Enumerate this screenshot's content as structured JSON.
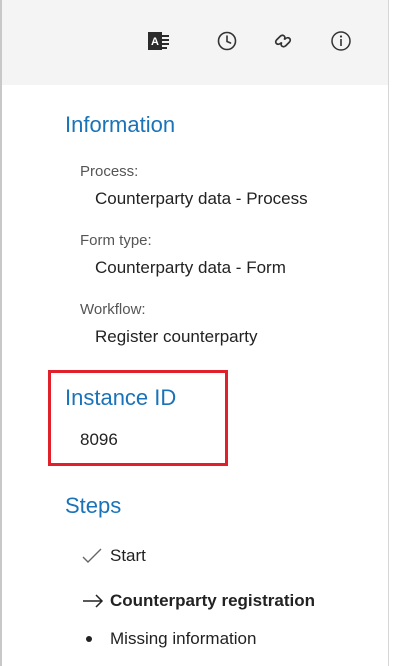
{
  "toolbar": {
    "icons": [
      "form-icon",
      "history-icon",
      "link-icon",
      "info-icon"
    ]
  },
  "information": {
    "title": "Information",
    "fields": [
      {
        "label": "Process:",
        "value": "Counterparty data - Process"
      },
      {
        "label": "Form type:",
        "value": "Counterparty data - Form"
      },
      {
        "label": "Workflow:",
        "value": "Register counterparty"
      }
    ]
  },
  "instance": {
    "title": "Instance ID",
    "value": "8096",
    "highlight_color": "#e0202a"
  },
  "steps": {
    "title": "Steps",
    "items": [
      {
        "label": "Start",
        "status": "done",
        "icon": "check-icon"
      },
      {
        "label": "Counterparty registration",
        "status": "current",
        "icon": "arrow-right-icon"
      },
      {
        "label": "Missing information",
        "status": "pending",
        "icon": "bullet-icon"
      }
    ]
  },
  "colors": {
    "accent": "#1a73b8",
    "toolbar_bg": "#f4f4f4"
  }
}
